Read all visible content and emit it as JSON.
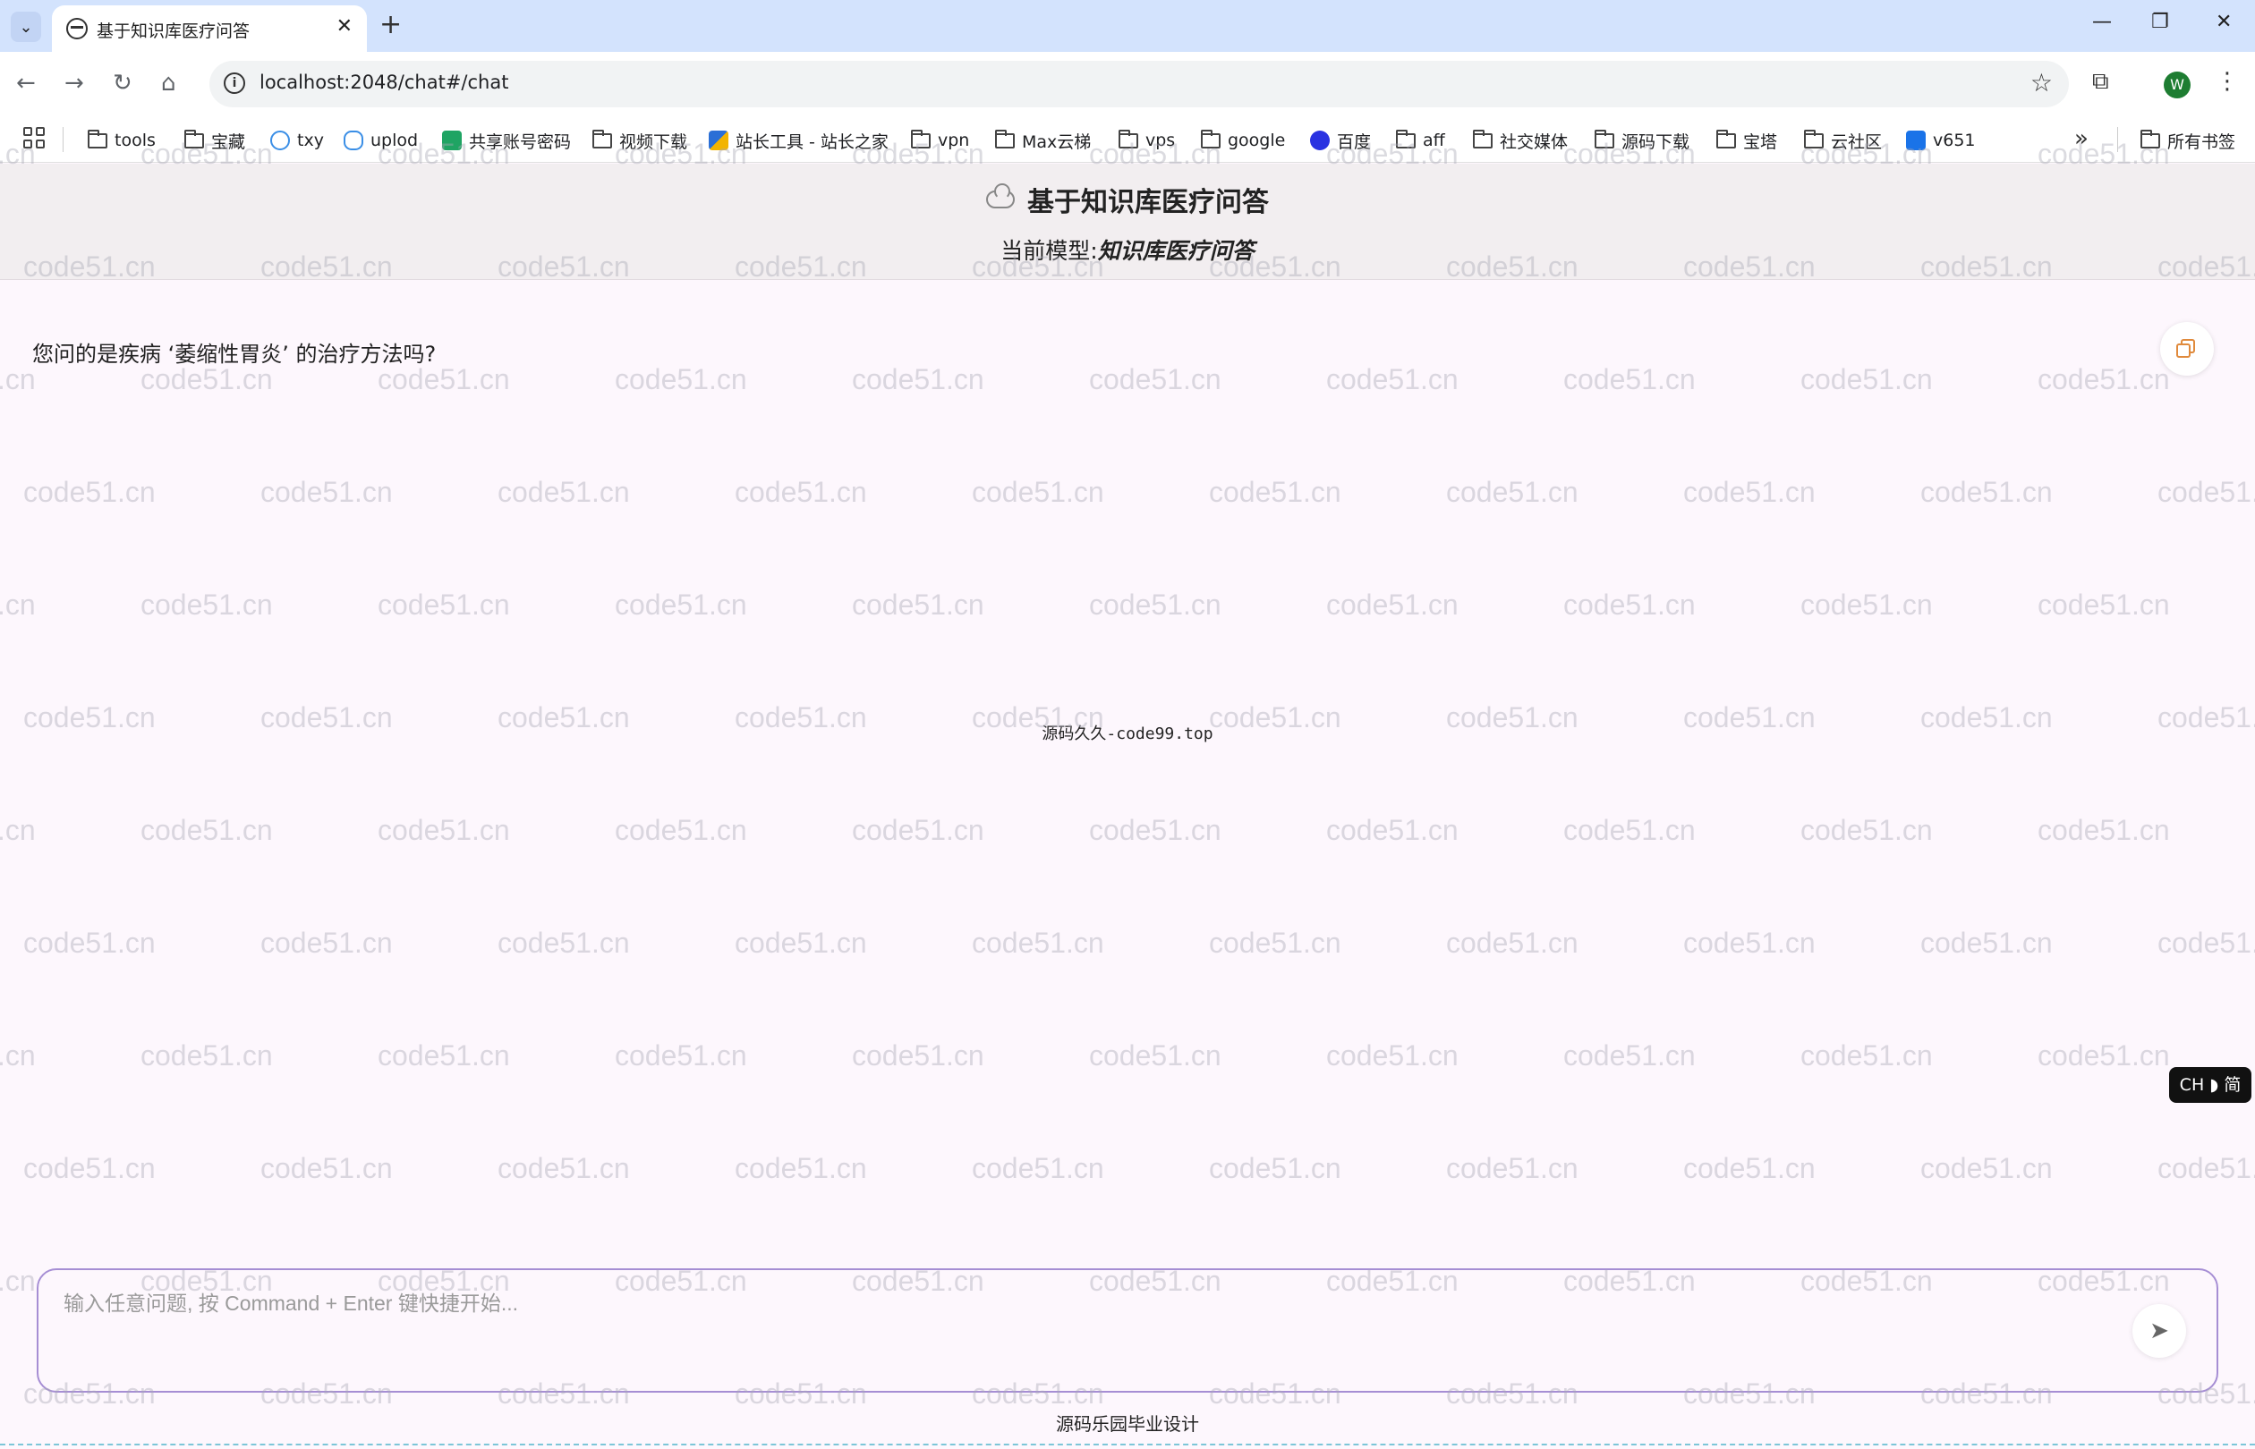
{
  "browser": {
    "tab_title": "基于知识库医疗问答",
    "url": "localhost:2048/chat#/chat",
    "avatar_letter": "W",
    "bookmarks": [
      "tools",
      "宝藏",
      "txy",
      "uplod",
      "共享账号密码",
      "视频下载",
      "站长工具 - 站长之家",
      "vpn",
      "Max云梯",
      "vps",
      "google",
      "百度",
      "aff",
      "社交媒体",
      "源码下载",
      "宝塔",
      "云社区",
      "v651"
    ],
    "all_bookmarks": "所有书签"
  },
  "header": {
    "title": "基于知识库医疗问答",
    "model_prefix": "当前模型:",
    "model_name": "知识库医疗问答"
  },
  "chat": {
    "message": "您问的是疾病 ‘萎缩性胃炎’ 的治疗方法吗?",
    "center_note": "源码久久-code99.top",
    "lang_badge": "CH ◗ 简"
  },
  "input": {
    "placeholder": "输入任意问题, 按 Command + Enter 键快捷开始..."
  },
  "footer": {
    "text": "源码乐园毕业设计"
  },
  "watermark": "code51.cn",
  "colors": {
    "tabbar": "#d3e3fd",
    "header_bg": "#f2eef0",
    "page_bg": "#fdf7fd",
    "input_border": "#a68ed4",
    "copy_accent": "#e08a3c"
  }
}
